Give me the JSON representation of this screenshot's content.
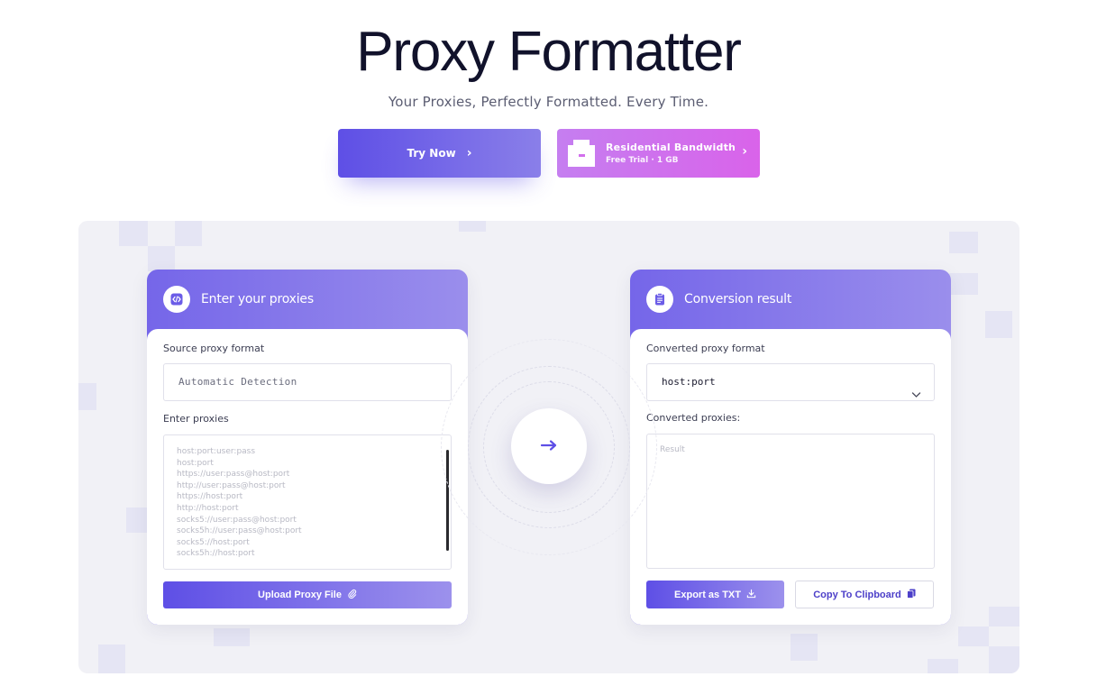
{
  "hero": {
    "title": "Proxy Formatter",
    "subtitle": "Your Proxies, Perfectly Formatted. Every Time."
  },
  "cta": {
    "try_label": "Try Now",
    "residential_title": "Residential Bandwidth",
    "residential_trial": "Free Trial",
    "residential_amount": "1 GB"
  },
  "input_card": {
    "title": "Enter your proxies",
    "source_format_label": "Source proxy format",
    "source_format_value": "Automatic Detection",
    "proxies_label": "Enter proxies",
    "placeholder_lines": [
      "host:port:user:pass",
      "host:port",
      "https://user:pass@host:port",
      "http://user:pass@host:port",
      "https://host:port",
      "http://host:port",
      "socks5://user:pass@host:port",
      "socks5h://user:pass@host:port",
      "socks5://host:port",
      "socks5h://host:port"
    ],
    "upload_label": "Upload Proxy File"
  },
  "output_card": {
    "title": "Conversion result",
    "converted_format_label": "Converted proxy format",
    "converted_format_value": "host:port",
    "converted_proxies_label": "Converted proxies:",
    "result_placeholder": "Result",
    "export_label": "Export as TXT",
    "copy_label": "Copy To Clipboard"
  },
  "colors": {
    "accent": "#5e4fe6",
    "accent_light": "#9a8eec",
    "residential": "#d26fed",
    "panel_bg": "#f1f1f6"
  },
  "icons": {
    "try_chevron": "chevron-right-icon",
    "residential": "residential-building-icon",
    "input_header": "code-icon",
    "output_header": "clipboard-icon",
    "upload": "paperclip-icon",
    "export": "download-icon",
    "copy": "copy-icon",
    "convert": "arrow-right-icon",
    "select": "chevron-down-icon"
  }
}
